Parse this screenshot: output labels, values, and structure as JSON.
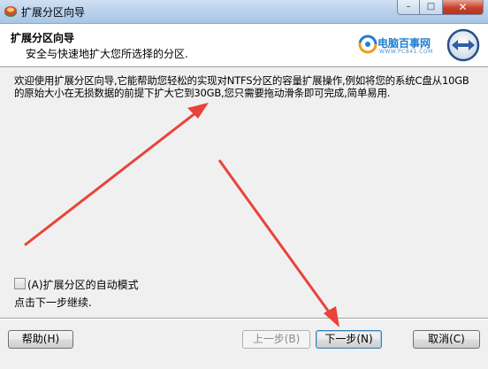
{
  "window": {
    "title": "扩展分区向导",
    "controls": {
      "minimize": "–",
      "maximize": "□",
      "close": "✕"
    }
  },
  "header": {
    "title": "扩展分区向导",
    "subtitle": "安全与快速地扩大您所选择的分区."
  },
  "logo": {
    "text": "电脑百事网",
    "sub": "WWW.PC841.COM"
  },
  "body": {
    "description": "欢迎使用扩展分区向导,它能帮助您轻松的实现对NTFS分区的容量扩展操作,例如将您的系统C盘从10GB的原始大小在无损数据的前提下扩大它到30GB,您只需要拖动滑条即可完成,简单易用.",
    "auto_mode": {
      "label": "(A)扩展分区的自动模式",
      "checked": false
    },
    "hint": "点击下一步继续."
  },
  "buttons": {
    "help": "帮助(H)",
    "back": "上一步(B)",
    "next": "下一步(N)",
    "cancel": "取消(C)"
  },
  "colors": {
    "annotation_arrow": "#e8433a",
    "logo_blue": "#1e7fd0",
    "title_bar": "#b9d1ec",
    "close_button": "#c8402b"
  },
  "icons": [
    "app-icon",
    "minimize-icon",
    "maximize-icon",
    "close-icon",
    "logo-icon",
    "wizard-arrows-icon"
  ]
}
